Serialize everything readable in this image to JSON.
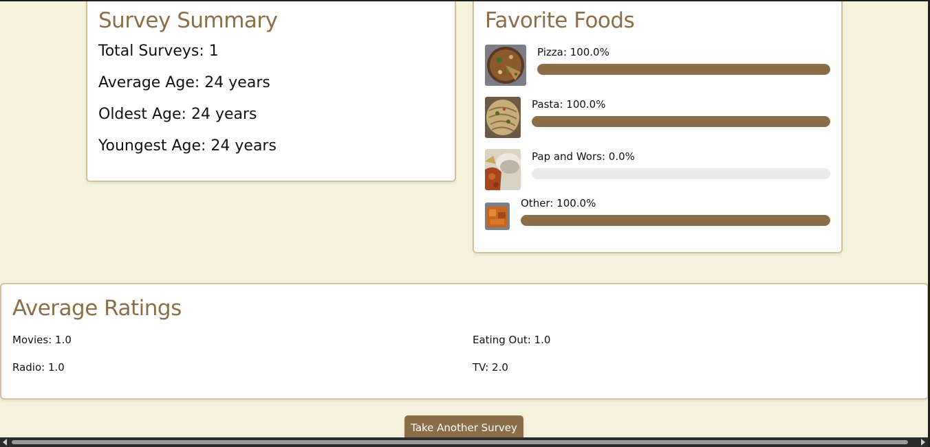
{
  "summary": {
    "title": "Survey Summary",
    "total_surveys": "Total Surveys: 1",
    "average_age": "Average Age: 24 years",
    "oldest_age": "Oldest Age: 24 years",
    "youngest_age": "Youngest Age: 24 years"
  },
  "foods": {
    "title": "Favorite Foods",
    "items": [
      {
        "label": "Pizza: 100.0%",
        "percent": 100,
        "image": "pizza-photo"
      },
      {
        "label": "Pasta: 100.0%",
        "percent": 100,
        "image": "pasta-photo"
      },
      {
        "label": "Pap and Wors: 0.0%",
        "percent": 0,
        "image": "pap-and-wors-photo"
      },
      {
        "label": "Other: 100.0%",
        "percent": 100,
        "image": "other-food-photo"
      }
    ]
  },
  "ratings": {
    "title": "Average Ratings",
    "movies": "Movies: 1.0",
    "eating_out": "Eating Out: 1.0",
    "radio": "Radio: 1.0",
    "tv": "TV: 2.0"
  },
  "actions": {
    "take_another_survey": "Take Another Survey"
  },
  "colors": {
    "accent": "#8b6e47",
    "background": "#f5f2dc",
    "card_border": "#d4c09a",
    "bar_track": "#e8ebee"
  }
}
